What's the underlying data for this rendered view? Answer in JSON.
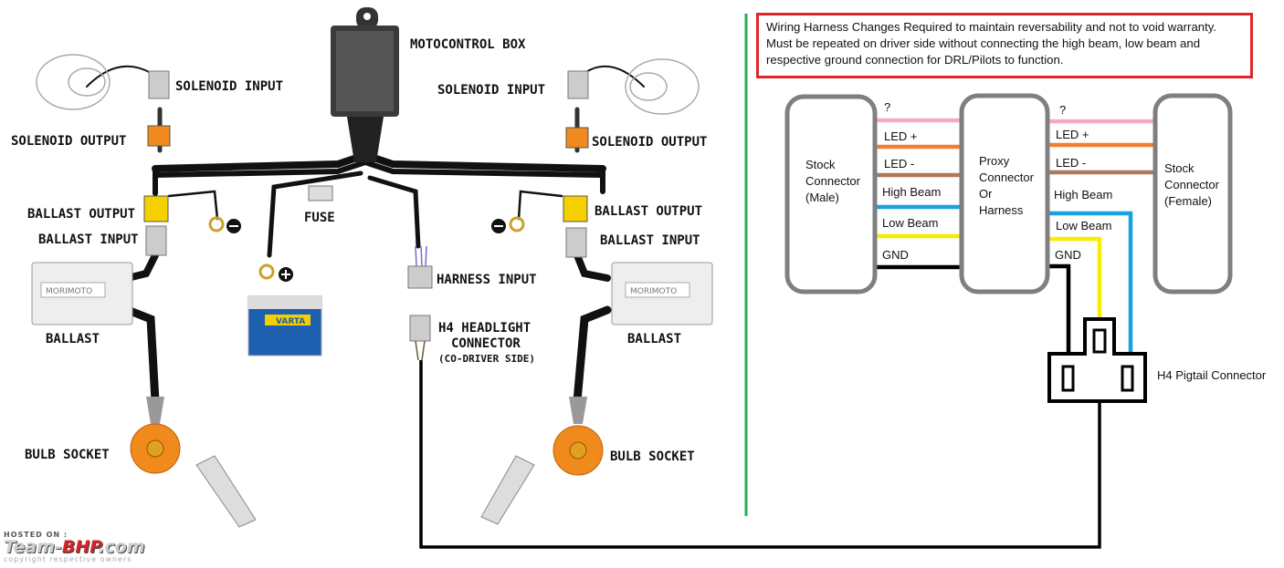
{
  "left_diagram": {
    "labels": {
      "motocontrol_box": "MOTOCONTROL BOX",
      "solenoid_input_left": "SOLENOID INPUT",
      "solenoid_output_left": "SOLENOID OUTPUT",
      "solenoid_input_right": "SOLENOID INPUT",
      "solenoid_output_right": "SOLENOID OUTPUT",
      "ballast_output_left": "BALLAST OUTPUT",
      "ballast_input_left": "BALLAST INPUT",
      "ballast_output_right": "BALLAST OUTPUT",
      "ballast_input_right": "BALLAST INPUT",
      "fuse": "FUSE",
      "harness_input": "HARNESS INPUT",
      "h4_line1": "H4 HEADLIGHT",
      "h4_line2": "CONNECTOR",
      "h4_line3": "(CO-DRIVER SIDE)",
      "ballast_left": "BALLAST",
      "ballast_right": "BALLAST",
      "bulb_socket_left": "BULB SOCKET",
      "bulb_socket_right": "BULB SOCKET",
      "ballast_brand": "MORIMOTO",
      "battery_brand": "VARTA"
    }
  },
  "note": {
    "lines": [
      "Wiring Harness Changes Required to maintain reversability and not to void warranty.",
      "Must be repeated on driver side without connecting the high beam, low beam and",
      "respective ground connection for DRL/Pilots to function."
    ],
    "border_color": "#e0262b"
  },
  "right_diagram": {
    "stock_male": [
      "Stock",
      "Connector",
      "(Male)"
    ],
    "proxy": [
      "Proxy",
      "Connector",
      "Or",
      "Harness"
    ],
    "stock_female": [
      "Stock",
      "Connector",
      "(Female)"
    ],
    "wires_left": [
      "?",
      "LED +",
      "LED -",
      "High Beam",
      "Low Beam",
      "GND"
    ],
    "wires_right": [
      "?",
      "LED +",
      "LED -",
      "High Beam",
      "Low Beam",
      "GND"
    ],
    "wire_colors": {
      "unknown": "#f5a9c8",
      "led_plus": "#f08030",
      "led_minus": "#b07858",
      "high_beam": "#18a0e0",
      "low_beam": "#f8ec00",
      "gnd": "#000000"
    },
    "pigtail_label": "H4 Pigtail Connector",
    "divider_color": "#22b14c"
  },
  "watermark": {
    "hosted": "HOSTED ON :",
    "brand_a": "Team-",
    "brand_b": "BHP",
    "brand_c": ".com",
    "copyright": "copyright respective owners"
  }
}
